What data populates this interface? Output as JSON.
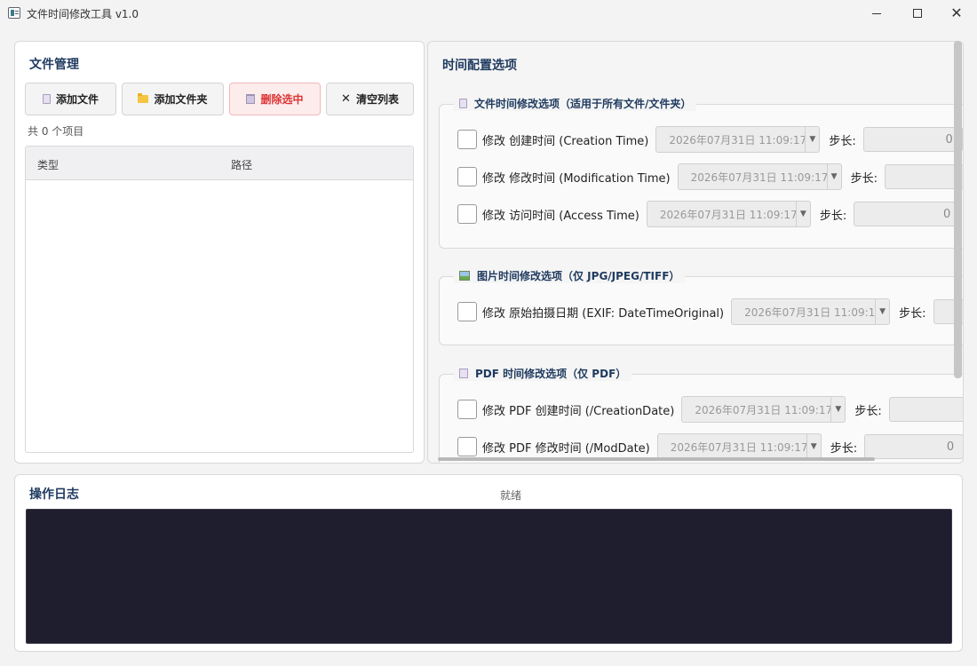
{
  "window": {
    "title": "文件时间修改工具 v1.0",
    "minimize_icon": "minimize-icon",
    "maximize_icon": "maximize-icon",
    "close_icon": "close-icon"
  },
  "files": {
    "title": "文件管理",
    "buttons": {
      "add_file": "添加文件",
      "add_folder": "添加文件夹",
      "delete_selected": "删除选中",
      "clear_list": "清空列表"
    },
    "count_label": "共 0 个项目",
    "columns": [
      "类型",
      "路径"
    ],
    "rows": []
  },
  "config": {
    "title": "时间配置选项",
    "groups": [
      {
        "title": "文件时间修改选项（适用于所有文件/文件夹）",
        "icon": "document-icon",
        "options": [
          {
            "label": "修改 创建时间 (Creation Time)",
            "datetime": "2026年07月31日 11:09:17",
            "step": "0"
          },
          {
            "label": "修改 修改时间 (Modification Time)",
            "datetime": "2026年07月31日 11:09:17",
            "step": ""
          },
          {
            "label": "修改 访问时间 (Access Time)",
            "datetime": "2026年07月31日 11:09:17",
            "step": "0"
          }
        ]
      },
      {
        "title": "图片时间修改选项（仅 JPG/JPEG/TIFF）",
        "icon": "image-icon",
        "options": [
          {
            "label": "修改 原始拍摄日期 (EXIF: DateTimeOriginal)",
            "datetime": "2026年07月31日 11:09:1",
            "step": ""
          }
        ]
      },
      {
        "title": "PDF 时间修改选项（仅 PDF）",
        "icon": "pdf-icon",
        "options": [
          {
            "label": "修改 PDF 创建时间 (/CreationDate)",
            "datetime": "2026年07月31日 11:09:17",
            "step": ""
          },
          {
            "label": "修改 PDF 修改时间 (/ModDate)",
            "datetime": "2026年07月31日 11:09:17",
            "step": "0"
          }
        ]
      }
    ],
    "step_label": "步长:"
  },
  "log": {
    "title": "操作日志",
    "status": "就绪",
    "content": ""
  }
}
